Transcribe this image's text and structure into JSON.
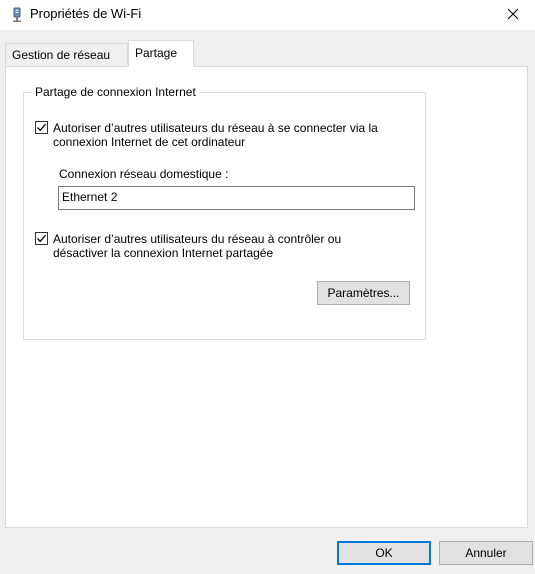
{
  "window": {
    "title": "Propriétés de Wi-Fi"
  },
  "tabs": [
    {
      "label": "Gestion de réseau",
      "selected": false
    },
    {
      "label": "Partage",
      "selected": true
    }
  ],
  "sharing": {
    "group_title": "Partage de connexion Internet",
    "allow_connect": {
      "checked": true,
      "label_line1": "Autoriser d’autres utilisateurs du réseau à se connecter via la",
      "label_line2": "connexion Internet de cet ordinateur"
    },
    "home_network": {
      "label": "Connexion réseau domestique :",
      "value": "Ethernet 2"
    },
    "allow_control": {
      "checked": true,
      "label_line1": "Autoriser d’autres utilisateurs du réseau à contrôler ou",
      "label_line2": "désactiver la connexion Internet partagée"
    },
    "settings_button": "Paramètres..."
  },
  "footer": {
    "ok_label": "OK",
    "cancel_label": "Annuler"
  }
}
